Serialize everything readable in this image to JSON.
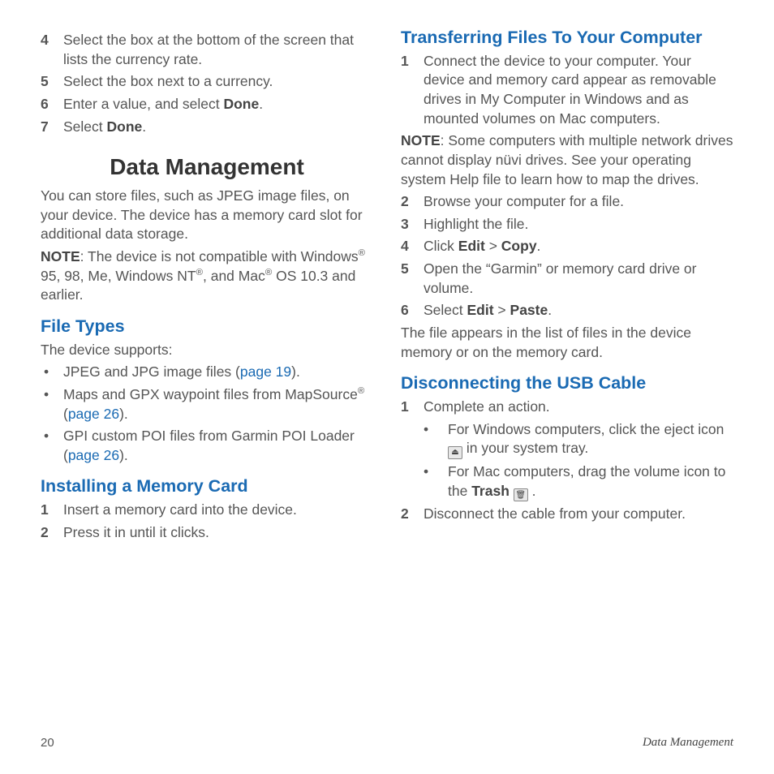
{
  "left": {
    "steps_top": [
      {
        "n": "4",
        "pre": "Select the box at the bottom of the screen that lists the currency rate."
      },
      {
        "n": "5",
        "pre": "Select the box next to a currency."
      },
      {
        "n": "6",
        "pre": "Enter a value, and select ",
        "bold": "Done",
        "post": "."
      },
      {
        "n": "7",
        "pre": "Select ",
        "bold": "Done",
        "post": "."
      }
    ],
    "main_heading": "Data Management",
    "intro": "You can store files, such as JPEG image files, on your device. The device has a memory card slot for additional data storage.",
    "note_label": "NOTE",
    "note_pre": ": The device is not compatible with Windows",
    "note_mid1": " 95, 98, Me, Windows NT",
    "note_mid2": ", and Mac",
    "note_post": " OS 10.3 and earlier.",
    "filetypes_heading": "File Types",
    "filetypes_intro": "The device supports:",
    "ft1_pre": "JPEG and JPG image files (",
    "ft1_link": "page 19",
    "ft1_post": ").",
    "ft2_pre": "Maps and GPX waypoint files from MapSource",
    "ft2_mid": " (",
    "ft2_link": "page 26",
    "ft2_post": ").",
    "ft3_pre": "GPI custom POI files from Garmin POI Loader (",
    "ft3_link": "page 26",
    "ft3_post": ").",
    "install_heading": "Installing a Memory Card",
    "install_steps": [
      {
        "n": "1",
        "pre": "Insert a memory card into the device."
      },
      {
        "n": "2",
        "pre": "Press it in until it clicks."
      }
    ]
  },
  "right": {
    "transfer_heading": "Transferring Files To Your Computer",
    "t1_n": "1",
    "t1_text": "Connect the device to your computer. Your device and memory card appear as removable drives in My Computer in Windows and as mounted volumes on Mac computers.",
    "t1_note_label": "NOTE",
    "t1_note": ": Some computers with multiple network drives cannot display nüvi drives. See your operating system Help file to learn how to map the drives.",
    "t2": {
      "n": "2",
      "pre": "Browse your computer for a file."
    },
    "t3": {
      "n": "3",
      "pre": "Highlight the file."
    },
    "t4": {
      "n": "4",
      "pre": "Click ",
      "b1": "Edit",
      "mid": " > ",
      "b2": "Copy",
      "post": "."
    },
    "t5": {
      "n": "5",
      "pre": "Open the “Garmin” or memory card drive or volume."
    },
    "t6": {
      "n": "6",
      "pre": "Select ",
      "b1": "Edit",
      "mid": " > ",
      "b2": "Paste",
      "post": "."
    },
    "t6_sub": "The file appears in the list of files in the device memory or on the memory card.",
    "disc_heading": "Disconnecting the USB Cable",
    "d1": {
      "n": "1",
      "pre": "Complete an action."
    },
    "d1a_pre": "For Windows computers, click the eject icon ",
    "d1a_post": " in your system tray.",
    "d1b_pre": "For Mac computers, drag the volume icon to the ",
    "d1b_bold": "Trash",
    "d1b_post": " .",
    "d2": {
      "n": "2",
      "pre": "Disconnect the cable from your computer."
    }
  },
  "footer": {
    "page": "20",
    "section": "Data Management"
  },
  "glyph": {
    "bullet": "•",
    "reg": "®"
  }
}
